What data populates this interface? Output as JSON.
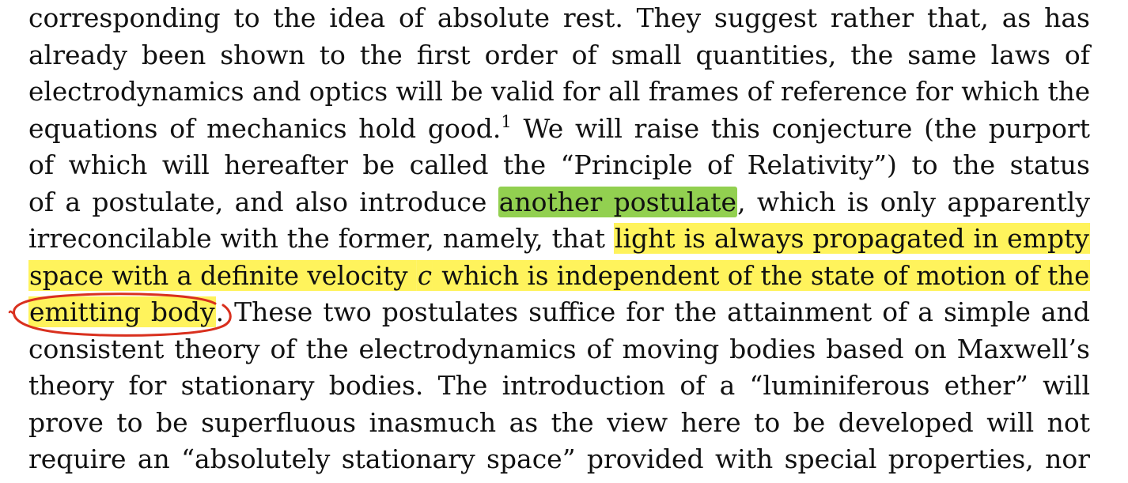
{
  "document": {
    "lines": [
      {
        "segments": [
          {
            "text": "corresponding to the idea of absolute rest.  They suggest rather that, as has",
            "style": "plain"
          }
        ]
      },
      {
        "segments": [
          {
            "text": "already been shown to the first order of small quantities, the same laws of",
            "style": "plain"
          }
        ]
      },
      {
        "segments": [
          {
            "text": "electrodynamics and optics will be valid for all frames of reference for which the",
            "style": "plain"
          }
        ]
      },
      {
        "segments": [
          {
            "text": "equations of mechanics hold good.",
            "style": "plain"
          },
          {
            "text": "1",
            "style": "sup"
          },
          {
            "text": "  We will raise this conjecture (the purport",
            "style": "plain"
          }
        ]
      },
      {
        "segments": [
          {
            "text": "of which will hereafter be called the “Principle of Relativity”) to the status",
            "style": "plain"
          }
        ]
      },
      {
        "segments": [
          {
            "text": "of a postulate, and also introduce ",
            "style": "plain"
          },
          {
            "text": "another postulate",
            "style": "green"
          },
          {
            "text": ", which is only apparently",
            "style": "plain"
          }
        ]
      },
      {
        "segments": [
          {
            "text": "irreconcilable with the former, namely, that ",
            "style": "plain"
          },
          {
            "text": "light is always propagated in empty",
            "style": "yellow"
          }
        ]
      },
      {
        "segments": [
          {
            "text": "space with a definite velocity ",
            "style": "yellow"
          },
          {
            "text": "c",
            "style": "yellow-italic"
          },
          {
            "text": " which is independent of the state of motion of the",
            "style": "yellow"
          }
        ]
      },
      {
        "segments": [
          {
            "text": "emitting body",
            "style": "yellow"
          },
          {
            "text": ". These two postulates suffice for the attainment of a simple and",
            "style": "plain"
          }
        ]
      },
      {
        "segments": [
          {
            "text": "consistent theory of the electrodynamics of moving bodies based on Maxwell’s",
            "style": "plain"
          }
        ]
      },
      {
        "segments": [
          {
            "text": "theory for stationary bodies.  The introduction of a “luminiferous ether” will",
            "style": "plain"
          }
        ]
      },
      {
        "segments": [
          {
            "text": "prove to be superfluous inasmuch as the view here to be developed will not",
            "style": "plain"
          }
        ]
      },
      {
        "segments": [
          {
            "text": "require an “absolutely stationary space” provided with special properties, nor",
            "style": "plain"
          }
        ]
      }
    ]
  },
  "colors": {
    "green_highlight": "#92d050",
    "yellow_highlight": "#fff35c",
    "circle_annotation": "#d9301e",
    "text": "#111111"
  },
  "annotations": {
    "circle_icon": "red-hand-drawn-circle-icon"
  }
}
